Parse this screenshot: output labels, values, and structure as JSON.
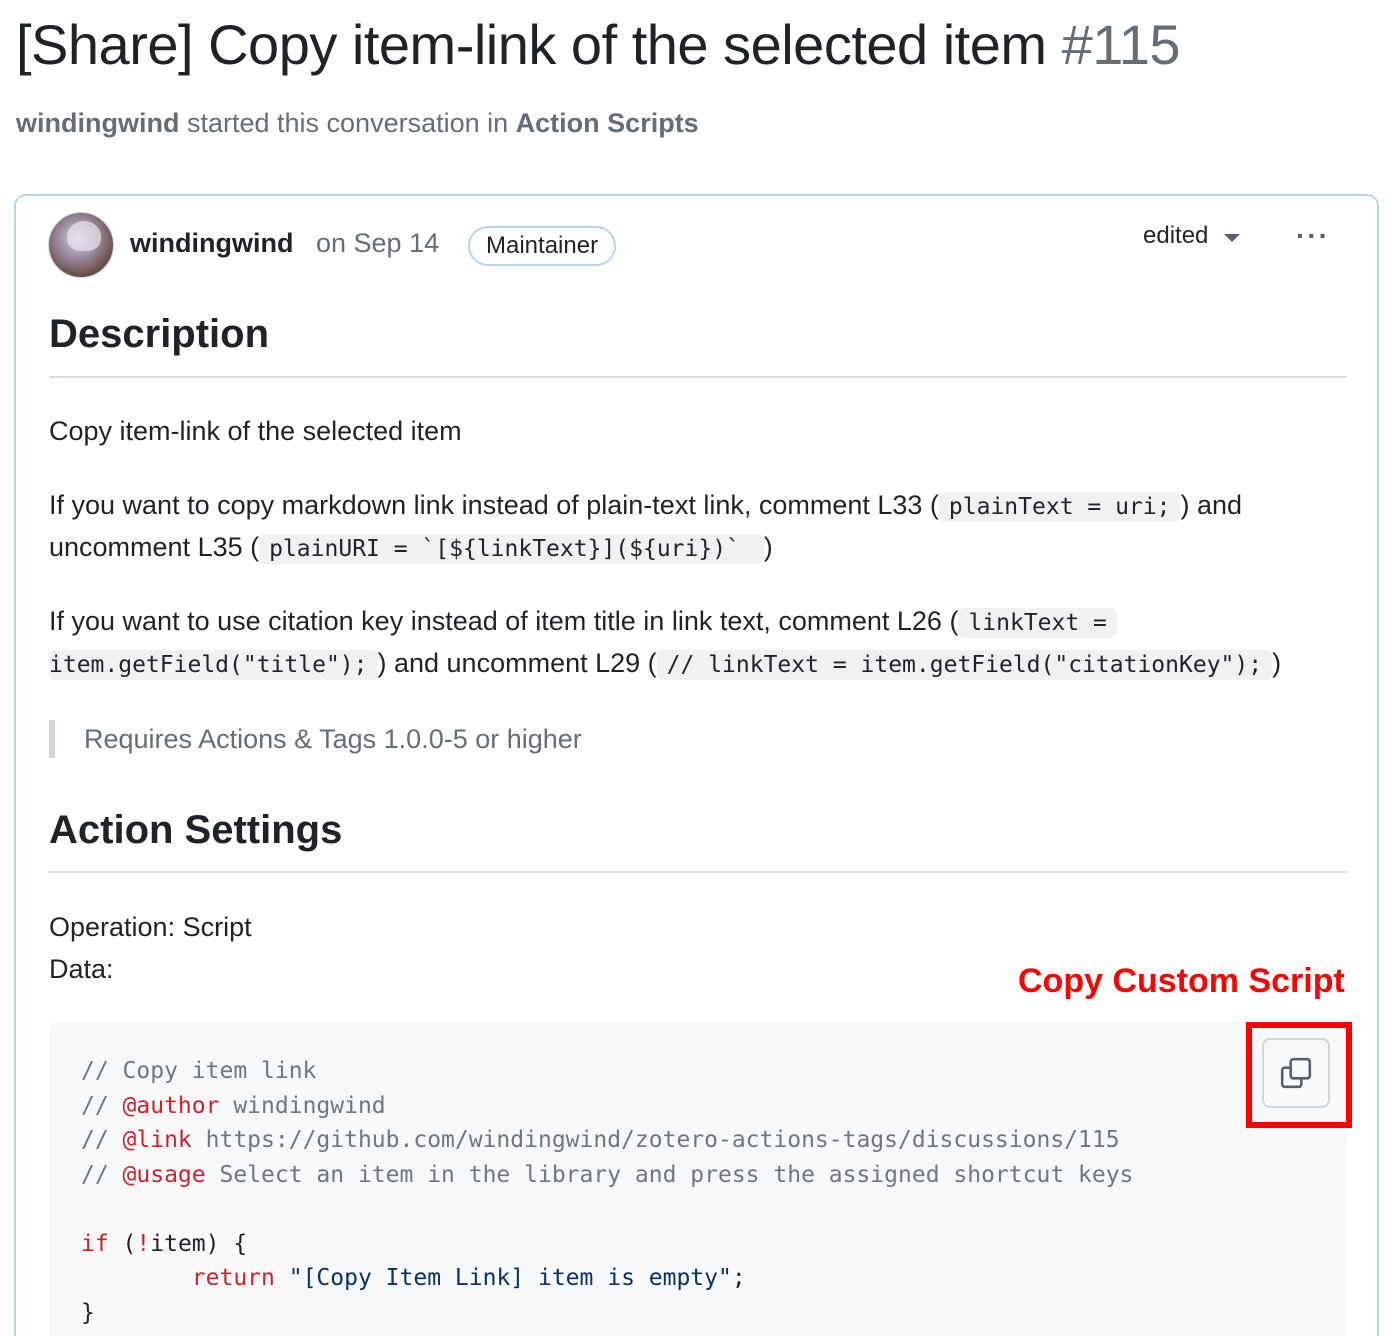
{
  "header": {
    "title": "[Share] Copy item-link of the selected item",
    "number": "#115",
    "starter": "windingwind",
    "started_text": "started this conversation in",
    "category": "Action Scripts"
  },
  "post": {
    "author": "windingwind",
    "date": "on Sep 14",
    "badge": "Maintainer",
    "edited_label": "edited",
    "more_label": "···"
  },
  "content": {
    "description_heading": "Description",
    "intro": "Copy item-link of the selected item",
    "para1": {
      "t1": "If you want to copy markdown link instead of plain-text link, comment L33 (",
      "c1": "plainText = uri;",
      "t2": ") and",
      "t3": "uncomment L35 (",
      "c2": "plainURI = `[${linkText}](${uri})` ",
      "t4": ")"
    },
    "para2": {
      "t1": "If you want to use citation key instead of item title in link text, comment L26 (",
      "c1": "linkText =",
      "c1b": "item.getField(\"title\");",
      "t2": ") and uncomment L29 (",
      "c2": "// linkText = item.getField(\"citationKey\");",
      "t3": ")"
    },
    "quote": "Requires Actions & Tags 1.0.0-5 or higher",
    "settings_heading": "Action Settings",
    "operation": "Operation: Script",
    "data_label": "Data:",
    "annotation": "Copy Custom Script"
  },
  "code": {
    "l1": "// Copy item link",
    "l2_pre": "// ",
    "l2_tag": "@author",
    "l2_rest": " windingwind",
    "l3_pre": "// ",
    "l3_tag": "@link",
    "l3_rest": " https://github.com/windingwind/zotero-actions-tags/discussions/115",
    "l4_pre": "// ",
    "l4_tag": "@usage",
    "l4_rest": " Select an item in the library and press the assigned shortcut keys",
    "l6_kw": "if",
    "l6_a": " (",
    "l6_op": "!",
    "l6_b": "item) {",
    "l7_indent": "        ",
    "l7_kw": "return",
    "l7_sp": " ",
    "l7_str": "\"[Copy Item Link] item is empty\"",
    "l7_end": ";",
    "l8": "}"
  },
  "colors": {
    "annotation": "#ff0000",
    "card_border": "#b6d4f2",
    "code_bg": "#f6f8fa"
  },
  "icons": {
    "copy": "copy-icon",
    "caret": "triangle-down-icon",
    "more": "kebab-horizontal-icon"
  }
}
